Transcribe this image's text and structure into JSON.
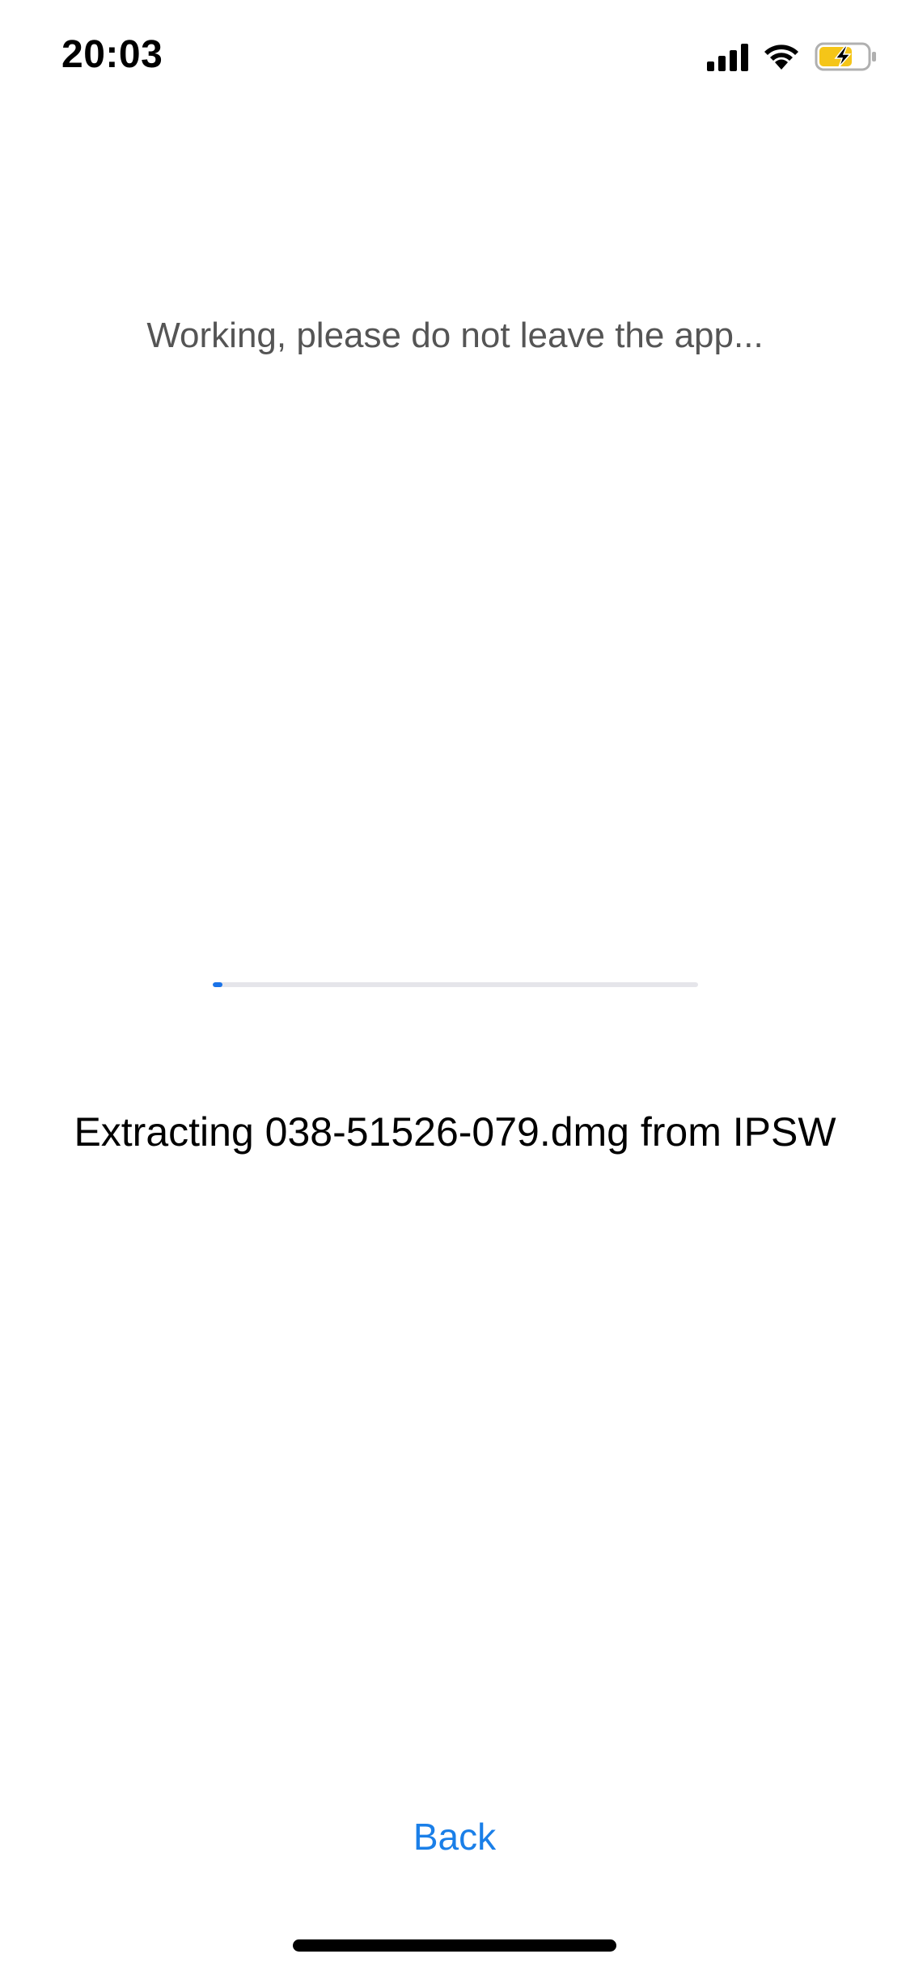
{
  "status_bar": {
    "time": "20:03",
    "icons": [
      "cellular-signal-icon",
      "wifi-icon",
      "battery-charging-icon"
    ],
    "battery_color": "#f5c518"
  },
  "main": {
    "heading": "Working, please do not leave the app...",
    "progress_fraction": 0.02,
    "status_text": "Extracting 038-51526-079.dmg from IPSW"
  },
  "footer": {
    "back_label": "Back"
  },
  "colors": {
    "accent": "#1a7fe8",
    "progress_fill": "#1a73e8",
    "progress_track": "#e5e5ea",
    "secondary_text": "#555555"
  }
}
